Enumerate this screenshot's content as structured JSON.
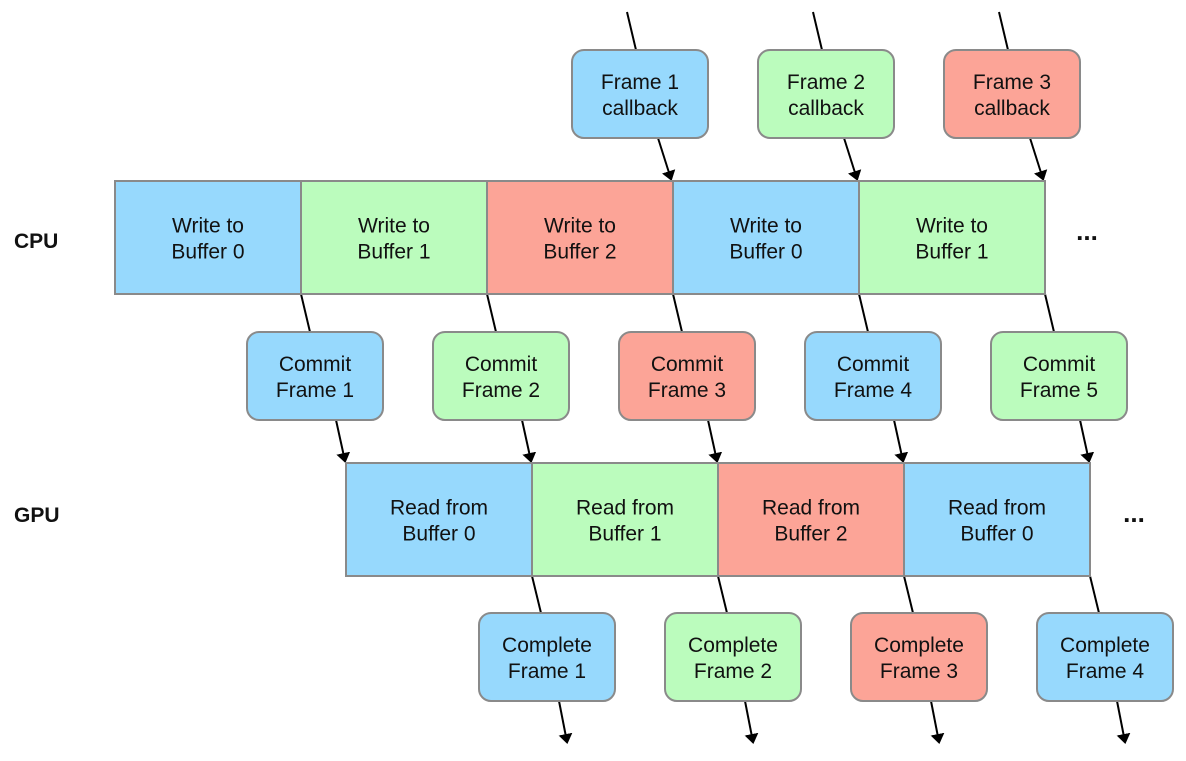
{
  "colors": {
    "blue": "#97d9fd",
    "green": "#bbfcbd",
    "red": "#fca497",
    "border": "#8a8a8a",
    "arrow": "#000000"
  },
  "rows": {
    "cpu_label": "CPU",
    "gpu_label": "GPU",
    "ellipsis": "..."
  },
  "callbacks": [
    {
      "line1": "Frame 1",
      "line2": "callback",
      "color": "blue"
    },
    {
      "line1": "Frame 2",
      "line2": "callback",
      "color": "green"
    },
    {
      "line1": "Frame 3",
      "line2": "callback",
      "color": "red"
    }
  ],
  "cpu_segments": [
    {
      "line1": "Write to",
      "line2": "Buffer 0",
      "color": "blue"
    },
    {
      "line1": "Write to",
      "line2": "Buffer 1",
      "color": "green"
    },
    {
      "line1": "Write to",
      "line2": "Buffer 2",
      "color": "red"
    },
    {
      "line1": "Write to",
      "line2": "Buffer 0",
      "color": "blue"
    },
    {
      "line1": "Write to",
      "line2": "Buffer 1",
      "color": "green"
    }
  ],
  "commits": [
    {
      "line1": "Commit",
      "line2": "Frame 1",
      "color": "blue"
    },
    {
      "line1": "Commit",
      "line2": "Frame 2",
      "color": "green"
    },
    {
      "line1": "Commit",
      "line2": "Frame 3",
      "color": "red"
    },
    {
      "line1": "Commit",
      "line2": "Frame 4",
      "color": "blue"
    },
    {
      "line1": "Commit",
      "line2": "Frame 5",
      "color": "green"
    }
  ],
  "gpu_segments": [
    {
      "line1": "Read from",
      "line2": "Buffer 0",
      "color": "blue"
    },
    {
      "line1": "Read from",
      "line2": "Buffer 1",
      "color": "green"
    },
    {
      "line1": "Read from",
      "line2": "Buffer 2",
      "color": "red"
    },
    {
      "line1": "Read from",
      "line2": "Buffer 0",
      "color": "blue"
    }
  ],
  "completes": [
    {
      "line1": "Complete",
      "line2": "Frame 1",
      "color": "blue"
    },
    {
      "line1": "Complete",
      "line2": "Frame 2",
      "color": "green"
    },
    {
      "line1": "Complete",
      "line2": "Frame 3",
      "color": "red"
    },
    {
      "line1": "Complete",
      "line2": "Frame 4",
      "color": "blue"
    }
  ]
}
